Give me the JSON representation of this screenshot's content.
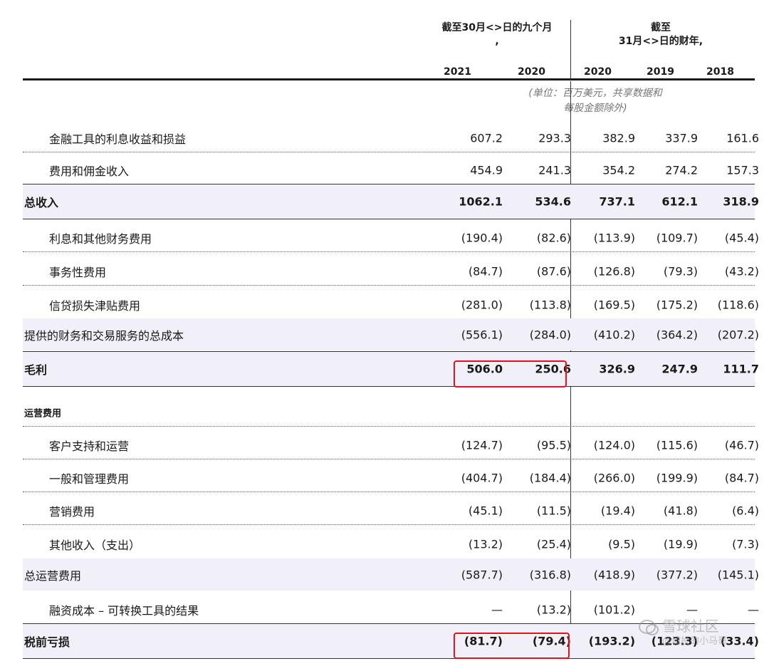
{
  "header": {
    "group1_line1": "截至30月<>日的九个月",
    "group1_line2": ",",
    "group2_line1": "截至",
    "group2_line2": "31月<>日的财年,",
    "years": [
      "2021",
      "2020",
      "2020",
      "2019",
      "2018"
    ],
    "unit_note_line1": "(单位：百万美元，共享数据和",
    "unit_note_line2": "每股金额除外)"
  },
  "rows": [
    {
      "label": "金融工具的利息收益和损益",
      "values": [
        "607.2",
        "293.3",
        "382.9",
        "337.9",
        "161.6"
      ]
    },
    {
      "label": "费用和佣金收入",
      "values": [
        "454.9",
        "241.3",
        "354.2",
        "274.2",
        "157.3"
      ]
    },
    {
      "label": "总收入",
      "values": [
        "1062.1",
        "534.6",
        "737.1",
        "612.1",
        "318.9"
      ]
    },
    {
      "label": "利息和其他财务费用",
      "values": [
        "(190.4)",
        "(82.6)",
        "(113.9)",
        "(109.7)",
        "(45.4)"
      ]
    },
    {
      "label": "事务性费用",
      "values": [
        "(84.7)",
        "(87.6)",
        "(126.8)",
        "(79.3)",
        "(43.2)"
      ]
    },
    {
      "label": "信贷损失津贴费用",
      "values": [
        "(281.0)",
        "(113.8)",
        "(169.5)",
        "(175.2)",
        "(118.6)"
      ]
    },
    {
      "label": "提供的财务和交易服务的总成本",
      "values": [
        "(556.1)",
        "(284.0)",
        "(410.2)",
        "(364.2)",
        "(207.2)"
      ]
    },
    {
      "label": "毛利",
      "values": [
        "506.0",
        "250.6",
        "326.9",
        "247.9",
        "111.7"
      ]
    },
    {
      "label": "运营费用",
      "values": []
    },
    {
      "label": "客户支持和运营",
      "values": [
        "(124.7)",
        "(95.5)",
        "(124.0)",
        "(115.6)",
        "(46.7)"
      ]
    },
    {
      "label": "一般和管理费用",
      "values": [
        "(404.7)",
        "(184.4)",
        "(266.0)",
        "(199.9)",
        "(84.7)"
      ]
    },
    {
      "label": "营销费用",
      "values": [
        "(45.1)",
        "(11.5)",
        "(19.4)",
        "(41.8)",
        "(6.4)"
      ]
    },
    {
      "label": "其他收入（支出）",
      "values": [
        "(13.2)",
        "(25.4)",
        "(9.5)",
        "(19.9)",
        "(7.3)"
      ]
    },
    {
      "label": "总运营费用",
      "values": [
        "(587.7)",
        "(316.8)",
        "(418.9)",
        "(377.2)",
        "(145.1)"
      ]
    },
    {
      "label": "融资成本 – 可转换工具的结果",
      "values": [
        "—",
        "(13.2)",
        "(101.2)",
        "—",
        "—"
      ]
    },
    {
      "label": "税前亏损",
      "values": [
        "(81.7)",
        "(79.4)",
        "(193.2)",
        "(123.3)",
        "(33.4)"
      ]
    }
  ],
  "watermark": {
    "line1": "雪球社区",
    "line2": "@城投的小马哥"
  },
  "colors": {
    "highlight": "#e0141e",
    "shade": "#f1eff7"
  }
}
